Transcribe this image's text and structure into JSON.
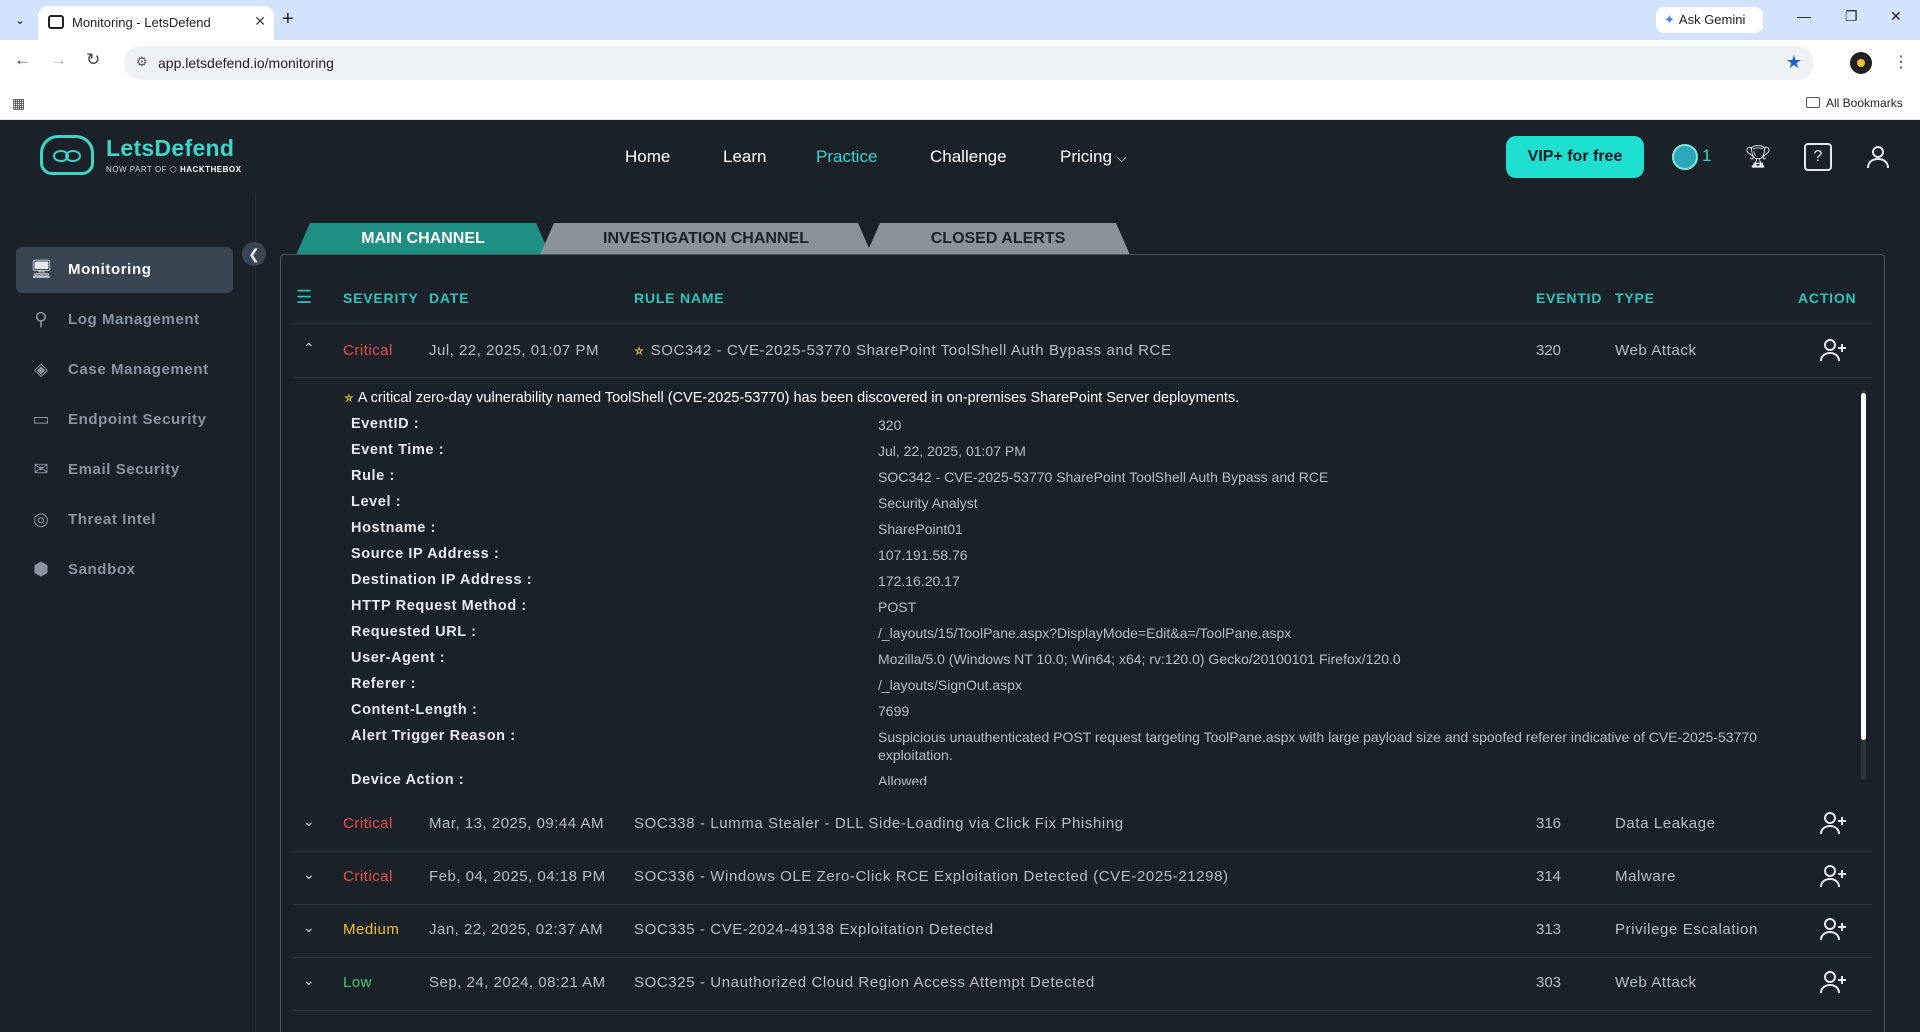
{
  "browser": {
    "tab_title": "Monitoring - LetsDefend",
    "url": "app.letsdefend.io/monitoring",
    "ask_gemini": "Ask Gemini",
    "all_bookmarks": "All Bookmarks"
  },
  "header": {
    "logo_name": "LetsDefend",
    "logo_sub_prefix": "NOW PART OF",
    "logo_sub_brand": "HACKTHEBOX",
    "nav": [
      {
        "label": "Home",
        "active": false
      },
      {
        "label": "Learn",
        "active": false
      },
      {
        "label": "Practice",
        "active": true
      },
      {
        "label": "Challenge",
        "active": false
      },
      {
        "label": "Pricing",
        "active": false
      }
    ],
    "vip_button": "VIP+ for free",
    "notification_count": "1"
  },
  "sidebar": {
    "items": [
      {
        "label": "Monitoring",
        "icon": "monitor-icon",
        "active": true
      },
      {
        "label": "Log Management",
        "icon": "search-icon",
        "active": false
      },
      {
        "label": "Case Management",
        "icon": "layers-icon",
        "active": false
      },
      {
        "label": "Endpoint Security",
        "icon": "drive-icon",
        "active": false
      },
      {
        "label": "Email Security",
        "icon": "mail-icon",
        "active": false
      },
      {
        "label": "Threat Intel",
        "icon": "lifebuoy-icon",
        "active": false
      },
      {
        "label": "Sandbox",
        "icon": "cube-icon",
        "active": false
      }
    ]
  },
  "channels": {
    "main": "MAIN CHANNEL",
    "investigation": "INVESTIGATION CHANNEL",
    "closed": "CLOSED ALERTS"
  },
  "table": {
    "columns": {
      "severity": "SEVERITY",
      "date": "DATE",
      "rule": "RULE NAME",
      "eventid": "EVENTID",
      "type": "TYPE",
      "action": "ACTION"
    },
    "rows": [
      {
        "severity": "Critical",
        "date": "Jul, 22, 2025, 01:07 PM",
        "rule": "SOC342 - CVE-2025-53770 SharePoint ToolShell Auth Bypass and RCE",
        "eventid": "320",
        "type": "Web Attack"
      },
      {
        "severity": "Critical",
        "date": "Mar, 13, 2025, 09:44 AM",
        "rule": "SOC338 - Lumma Stealer - DLL Side-Loading via Click Fix Phishing",
        "eventid": "316",
        "type": "Data Leakage"
      },
      {
        "severity": "Critical",
        "date": "Feb, 04, 2025, 04:18 PM",
        "rule": "SOC336 - Windows OLE Zero-Click RCE Exploitation Detected (CVE-2025-21298)",
        "eventid": "314",
        "type": "Malware"
      },
      {
        "severity": "Medium",
        "date": "Jan, 22, 2025, 02:37 AM",
        "rule": "SOC335 - CVE-2024-49138 Exploitation Detected",
        "eventid": "313",
        "type": "Privilege Escalation"
      },
      {
        "severity": "Low",
        "date": "Sep, 24, 2024, 08:21 AM",
        "rule": "SOC325 - Unauthorized Cloud Region Access Attempt Detected",
        "eventid": "303",
        "type": "Web Attack"
      }
    ]
  },
  "detail": {
    "title": "A critical zero-day vulnerability named ToolShell (CVE-2025-53770) has been discovered in on-premises SharePoint Server deployments.",
    "fields": [
      {
        "key": "EventID :",
        "value": "320"
      },
      {
        "key": "Event Time :",
        "value": "Jul, 22, 2025, 01:07 PM"
      },
      {
        "key": "Rule :",
        "value": "SOC342 - CVE-2025-53770 SharePoint ToolShell Auth Bypass and RCE"
      },
      {
        "key": "Level :",
        "value": "Security Analyst"
      },
      {
        "key": "Hostname :",
        "value": "SharePoint01"
      },
      {
        "key": "Source IP Address :",
        "value": "107.191.58.76"
      },
      {
        "key": "Destination IP Address :",
        "value": "172.16.20.17"
      },
      {
        "key": "HTTP Request Method :",
        "value": "POST"
      },
      {
        "key": "Requested URL :",
        "value": "/_layouts/15/ToolPane.aspx?DisplayMode=Edit&a=/ToolPane.aspx"
      },
      {
        "key": "User-Agent :",
        "value": "Mozilla/5.0 (Windows NT 10.0; Win64; x64; rv:120.0) Gecko/20100101 Firefox/120.0"
      },
      {
        "key": "Referer :",
        "value": "/_layouts/SignOut.aspx"
      },
      {
        "key": "Content-Length :",
        "value": "7699"
      },
      {
        "key": "Alert Trigger Reason :",
        "value": "Suspicious unauthenticated POST request targeting ToolPane.aspx with large payload size and spoofed referer indicative of CVE-2025-53770 exploitation."
      },
      {
        "key": "Device Action :",
        "value": "Allowed"
      }
    ]
  }
}
